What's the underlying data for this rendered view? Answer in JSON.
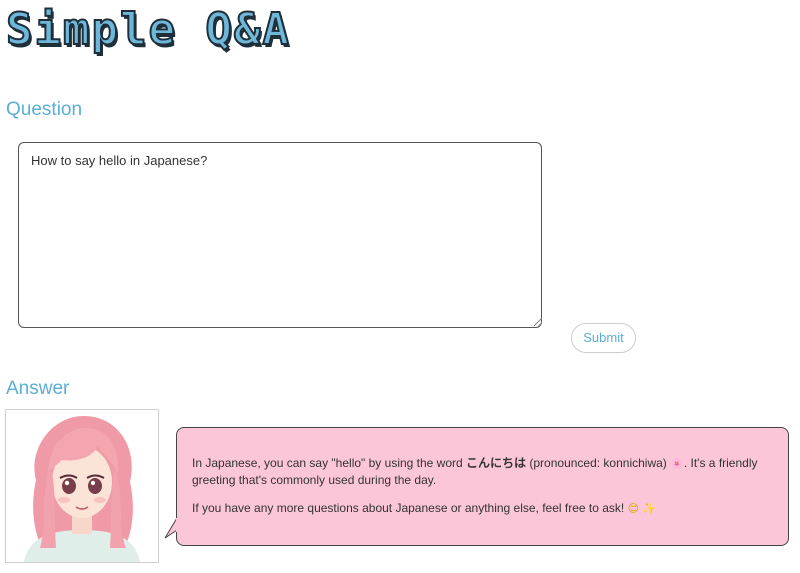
{
  "app": {
    "logo_text": "Simple Q&A"
  },
  "question": {
    "heading": "Question",
    "input_value": "How to say hello in Japanese?",
    "submit_label": "Submit"
  },
  "answer": {
    "heading": "Answer",
    "para1_before": "In Japanese, you can say \"hello\" by using the word ",
    "para1_bold": "こんにちは",
    "para1_middle": " (pronounced: konnichiwa) ",
    "para1_emoji": "🌸",
    "para1_after": ". It's a friendly greeting that's commonly used during the day.",
    "para2_text": "If you have any more questions about Japanese or anything else, feel free to ask! ",
    "para2_emoji1": "😊",
    "para2_emoji2": "✨"
  },
  "colors": {
    "accent": "#5aaed6",
    "bubble_bg": "#fbc6d8",
    "logo_fill": "#6fb7d9"
  },
  "icons": {
    "avatar": "anime-girl-avatar"
  }
}
